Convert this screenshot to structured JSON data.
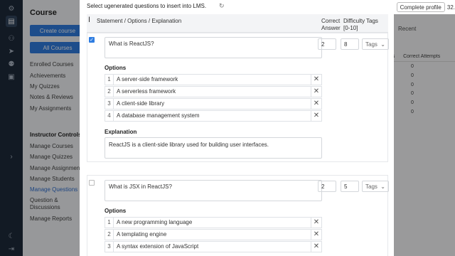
{
  "sidebar": {
    "course_title": "Course",
    "create_course": "Create course",
    "all_courses": "All Courses",
    "links": [
      "Enrolled Courses",
      "Achievements",
      "My Quizzes",
      "Notes & Reviews",
      "My Assignments"
    ],
    "instructor_heading": "Instructor Controls",
    "instructor_links": [
      "Manage Courses",
      "Manage Quizzes",
      "Manage Assignments",
      "Manage Students",
      "Manage Questions",
      "Question &",
      "Discussions",
      "Manage Reports"
    ]
  },
  "background": {
    "recent": "Recent",
    "col_a": "gs",
    "col_b": "Correct Attempts",
    "zeros": [
      "0",
      "0",
      "0",
      "0",
      "0",
      "0"
    ]
  },
  "topbar": {
    "complete_profile": "Complete profile",
    "count": "32."
  },
  "modal": {
    "title": "Select ugenerated questions to insert into LMS.",
    "headers": {
      "statement": "Statement / Options / Explanation",
      "correct": "Correct",
      "answer": "Answer",
      "difficulty": "Difficulty",
      "range": "[0-10]",
      "tags": "Tags"
    },
    "options_label": "Options",
    "explanation_label": "Explanation",
    "tags_placeholder": "Tags",
    "questions": [
      {
        "checked": true,
        "statement": "What is ReactJS?",
        "correct": "2",
        "difficulty": "8",
        "options": [
          {
            "n": "1",
            "text": "A server-side framework"
          },
          {
            "n": "2",
            "text": "A serverless framework"
          },
          {
            "n": "3",
            "text": "A client-side library"
          },
          {
            "n": "4",
            "text": "A database management system"
          }
        ],
        "explanation": "ReactJS is a client-side library used for building user interfaces."
      },
      {
        "checked": false,
        "statement": "What is JSX in ReactJS?",
        "correct": "2",
        "difficulty": "5",
        "options": [
          {
            "n": "1",
            "text": "A new programming language"
          },
          {
            "n": "2",
            "text": "A templating engine"
          },
          {
            "n": "3",
            "text": "A syntax extension of JavaScript"
          }
        ]
      }
    ]
  }
}
